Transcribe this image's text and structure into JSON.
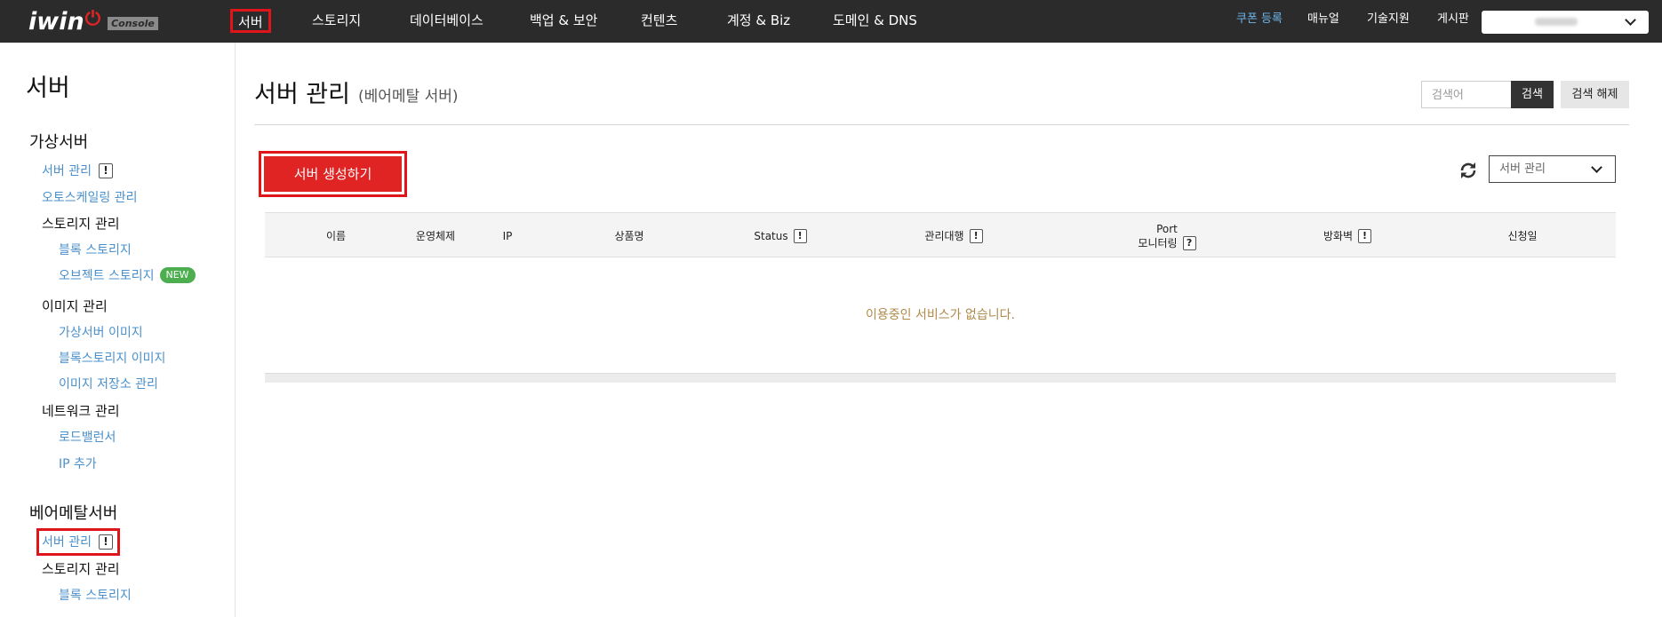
{
  "header": {
    "logo_text": "iwin",
    "logo_badge": "Console",
    "nav": [
      "서버",
      "스토리지",
      "데이터베이스",
      "백업 & 보안",
      "컨텐츠",
      "계정 & Biz",
      "도메인 & DNS"
    ],
    "links": {
      "coupon": "쿠폰 등록",
      "manual": "매뉴얼",
      "support": "기술지원",
      "board": "게시판"
    },
    "colors": {
      "bar": "#2b2b2b",
      "coupon": "#6fb5e8",
      "highlight": "#e0151a"
    }
  },
  "sidebar": {
    "title": "서버",
    "virtual": {
      "heading": "가상서버",
      "server_mgmt": "서버 관리",
      "autoscaling": "오토스케일링 관리",
      "storage_heading": "스토리지 관리",
      "block_storage": "블록 스토리지",
      "object_storage": "오브젝트 스토리지",
      "new_badge": "NEW",
      "image_heading": "이미지 관리",
      "virtual_image": "가상서버 이미지",
      "block_image": "블록스토리지 이미지",
      "image_repo": "이미지 저장소 관리",
      "network_heading": "네트워크 관리",
      "load_balancer": "로드밸런서",
      "add_ip": "IP 추가"
    },
    "baremetal": {
      "heading": "베어메탈서버",
      "server_mgmt": "서버 관리",
      "storage_heading": "스토리지 관리",
      "block_storage": "블록 스토리지"
    }
  },
  "main": {
    "title": "서버 관리",
    "subtitle": "(베어메탈 서버)",
    "search": {
      "placeholder": "검색어",
      "button": "검색",
      "reset": "검색 해제"
    },
    "create_button": "서버 생성하기",
    "filter_value": "서버 관리",
    "table": {
      "columns": {
        "name": "이름",
        "os": "운영체제",
        "ip": "IP",
        "product": "상품명",
        "status": "Status",
        "managed": "관리대행",
        "port_line1": "Port",
        "port_line2": "모니터링",
        "firewall": "방화벽",
        "date": "신청일"
      },
      "empty_message": "이용중인 서비스가 없습니다."
    }
  }
}
